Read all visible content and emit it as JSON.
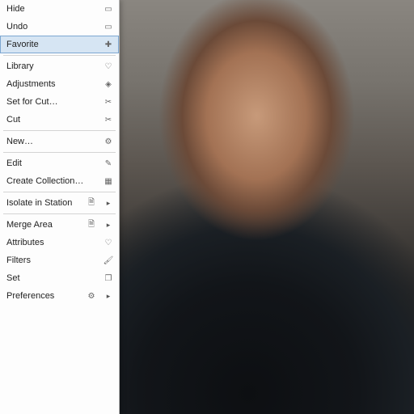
{
  "menu": {
    "groups": [
      {
        "items": [
          {
            "label": "Hide",
            "icon": "document-icon",
            "interact": true,
            "selected": false,
            "arrow": false
          },
          {
            "label": "Undo",
            "icon": "document-icon",
            "interact": true,
            "selected": false,
            "arrow": false
          },
          {
            "label": "Favorite",
            "icon": "add-icon",
            "interact": true,
            "selected": true,
            "arrow": false
          }
        ]
      },
      {
        "items": [
          {
            "label": "Library",
            "icon": "heart-icon",
            "interact": true,
            "selected": false,
            "arrow": false
          },
          {
            "label": "Adjustments",
            "icon": "diamond-icon",
            "interact": true,
            "selected": false,
            "arrow": false
          },
          {
            "label": "Set for Cut…",
            "icon": "scissors-icon",
            "interact": true,
            "selected": false,
            "arrow": false
          },
          {
            "label": "Cut",
            "icon": "scissors-icon",
            "interact": true,
            "selected": false,
            "arrow": false
          }
        ]
      },
      {
        "items": [
          {
            "label": "New…",
            "icon": "gear-icon",
            "interact": true,
            "selected": false,
            "arrow": false
          }
        ]
      },
      {
        "items": [
          {
            "label": "Edit",
            "icon": "pencil-icon",
            "interact": true,
            "selected": false,
            "arrow": false
          },
          {
            "label": "Create Collection…",
            "icon": "grid-icon",
            "interact": true,
            "selected": false,
            "arrow": false
          }
        ]
      },
      {
        "items": [
          {
            "label": "Isolate in Station",
            "icon": "page-icon",
            "interact": true,
            "selected": false,
            "arrow": true
          }
        ]
      },
      {
        "items": [
          {
            "label": "Merge Area",
            "icon": "page-icon",
            "interact": true,
            "selected": false,
            "arrow": true
          },
          {
            "label": "Attributes",
            "icon": "heart-icon",
            "interact": true,
            "selected": false,
            "arrow": false
          },
          {
            "label": "Filters",
            "icon": "paint-icon",
            "interact": true,
            "selected": false,
            "arrow": false
          },
          {
            "label": "Set",
            "icon": "window-icon",
            "interact": true,
            "selected": false,
            "arrow": false
          },
          {
            "label": "Preferences",
            "icon": "gear-icon",
            "interact": true,
            "selected": false,
            "arrow": true
          }
        ]
      }
    ]
  },
  "icons": {
    "document-icon": "▭",
    "add-icon": "✚",
    "heart-icon": "♡",
    "diamond-icon": "◈",
    "scissors-icon": "✂",
    "gear-icon": "⚙",
    "pencil-icon": "✎",
    "grid-icon": "▦",
    "page-icon": "🗎",
    "paint-icon": "🖌",
    "window-icon": "❐"
  }
}
